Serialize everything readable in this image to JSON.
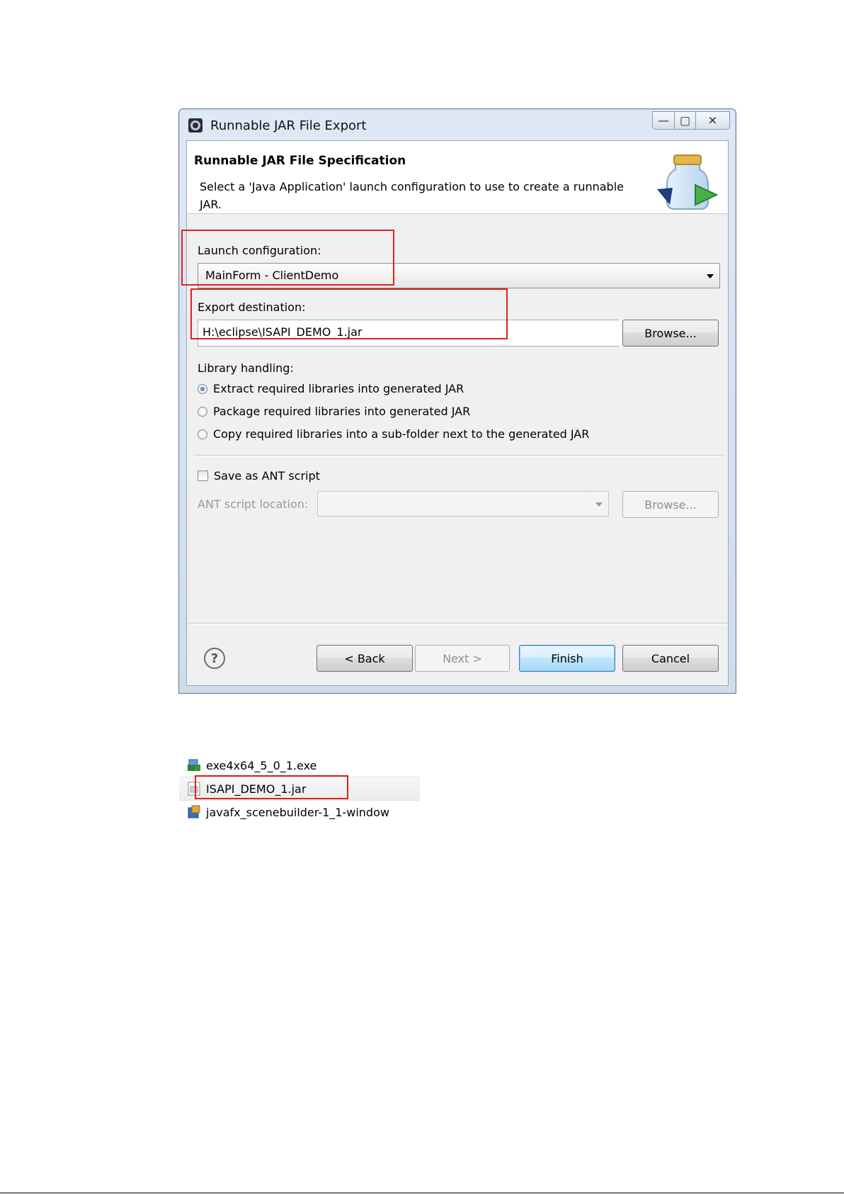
{
  "dialog": {
    "title": "Runnable JAR File Export",
    "page_title": "Runnable JAR File Specification",
    "page_description": "Select a 'Java Application' launch configuration to use to create a runnable JAR.",
    "launch_config": {
      "label": "Launch configuration:",
      "value": "MainForm - ClientDemo"
    },
    "export_destination": {
      "label": "Export destination:",
      "value": "H:\\eclipse\\ISAPI_DEMO_1.jar",
      "browse_label": "Browse..."
    },
    "library_handling": {
      "label": "Library handling:",
      "options": [
        {
          "label": "Extract required libraries into generated JAR",
          "selected": true
        },
        {
          "label": "Package required libraries into generated JAR",
          "selected": false
        },
        {
          "label": "Copy required libraries into a sub-folder next to the generated JAR",
          "selected": false
        }
      ]
    },
    "ant": {
      "checkbox_label": "Save as ANT script",
      "checked": false,
      "location_label": "ANT script location:",
      "location_value": "",
      "browse_label": "Browse..."
    },
    "buttons": {
      "help": "?",
      "back": "< Back",
      "next": "Next >",
      "finish": "Finish",
      "cancel": "Cancel"
    },
    "window_controls": {
      "minimize": "—",
      "maximize": "▢",
      "close": "✕"
    }
  },
  "explorer": {
    "files": [
      {
        "name": "exe4x64_5_0_1.exe",
        "icon": "exe-installer-icon"
      },
      {
        "name": "ISAPI_DEMO_1.jar",
        "icon": "jar-file-icon"
      },
      {
        "name": "javafx_scenebuilder-1_1-window",
        "icon": "msi-installer-icon"
      }
    ]
  },
  "colors": {
    "highlight_box": "#e0201a",
    "dialog_frame": "#cfdceb",
    "default_button": "#a7d9f5"
  }
}
